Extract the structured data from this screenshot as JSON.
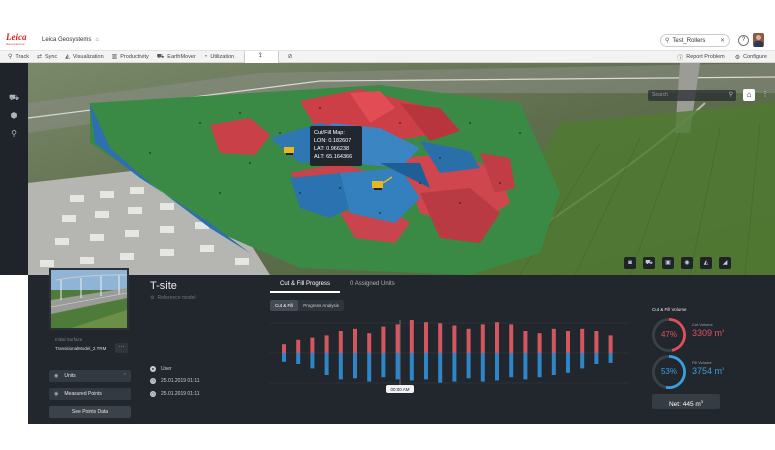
{
  "header": {
    "logo_text": "Leica",
    "logo_sub": "Geosystems",
    "company_name": "Leica Geosystems",
    "search_value": "Test_Rollers",
    "help_icon": "help-icon",
    "colors": {
      "brand": "#d8211d"
    }
  },
  "nav": {
    "items": [
      {
        "label": "Track",
        "icon": "location-pin-icon"
      },
      {
        "label": "Sync",
        "icon": "sync-icon"
      },
      {
        "label": "Visualization",
        "icon": "visualization-icon"
      },
      {
        "label": "Productivity",
        "icon": "bar-chart-icon"
      },
      {
        "label": "EarthMover",
        "icon": "earthmover-icon"
      },
      {
        "label": "Utilization",
        "icon": "utilization-icon"
      }
    ],
    "active_icon": "survey-pole-icon",
    "extra_icon": "compass-icon",
    "report_problem": "Report Problem",
    "configure": "Configure"
  },
  "map": {
    "search_placeholder": "Search",
    "tooltip": {
      "title": "Cut/Fill Map:",
      "lon": "LON: 0.182607",
      "lat": "LAT: 0.966238",
      "alt": "ALT: 65.164366"
    },
    "colors": {
      "cut": "#c94049",
      "fill": "#2e77b3",
      "neutral": "#3d8a4e"
    }
  },
  "site": {
    "title": "T-site",
    "reference_model": "Reference model",
    "initial_surface_label": "Initial Surface",
    "initial_surface_value": "TransitionalModel_2.TRM",
    "units_label": "Units",
    "measured_points_label": "Measured Points",
    "see_points_label": "See Points Data",
    "user_label": "User",
    "date1": "25.01.2019 01:11",
    "date2": "25.01.2019 01:11"
  },
  "tabs": [
    {
      "label": "Cut & Fill Progress"
    },
    {
      "label": "0 Assigned Units"
    }
  ],
  "subtabs": [
    {
      "label": "Cut & Fill"
    },
    {
      "label": "Progress Analysis"
    }
  ],
  "chart_data": {
    "type": "bar",
    "marker_label": "00:00 AM",
    "series": [
      {
        "name": "Fill",
        "color": "#2e86c9",
        "values": [
          8,
          10,
          14,
          20,
          24,
          23,
          26,
          22,
          24,
          25,
          24,
          27,
          26,
          23,
          26,
          25,
          22,
          24,
          22,
          20,
          18,
          14,
          10,
          9
        ]
      },
      {
        "name": "Cut",
        "color": "#d45760",
        "values": [
          8,
          12,
          14,
          16,
          20,
          22,
          18,
          24,
          26,
          30,
          28,
          27,
          25,
          22,
          26,
          28,
          26,
          20,
          18,
          22,
          20,
          22,
          20,
          16
        ]
      }
    ]
  },
  "volume": {
    "title": "Cut & Fill Volume",
    "cut": {
      "percent": "47%",
      "label": "Cut Volume",
      "value": "3309 m",
      "fraction": 0.47
    },
    "fill": {
      "percent": "53%",
      "label": "Fill Volume",
      "value": "3754 m",
      "fraction": 0.53
    },
    "net": "Net: 445 m",
    "colors": {
      "cut": "#e0505c",
      "fill": "#3aa0e0"
    }
  }
}
